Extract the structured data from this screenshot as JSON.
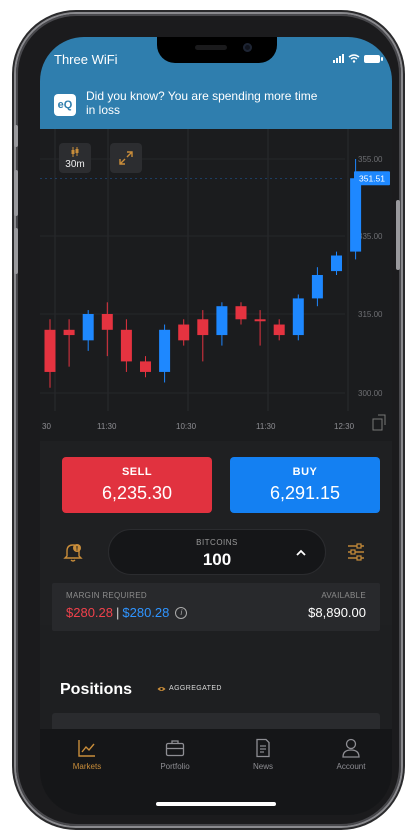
{
  "status_bar": {
    "carrier": "Three WiFi"
  },
  "tip_banner": {
    "logo_text": "eQ",
    "text": "Did you know? You are spending more time in loss"
  },
  "chart_toolbar": {
    "timeframe": "30m"
  },
  "chart_data": {
    "type": "candlestick",
    "y_ticks": [
      "355.00",
      "335.00",
      "315.00",
      "300.00"
    ],
    "x_ticks": [
      "30",
      "11:30",
      "10:30",
      "11:30",
      "12:30"
    ],
    "current_price_label": "351.51",
    "candles": [
      {
        "o": 312,
        "c": 304,
        "h": 314,
        "l": 301,
        "dir": "bearish"
      },
      {
        "o": 311,
        "c": 312,
        "h": 314,
        "l": 305,
        "dir": "bearish"
      },
      {
        "o": 310,
        "c": 315,
        "h": 316,
        "l": 308,
        "dir": "bullish"
      },
      {
        "o": 315,
        "c": 312,
        "h": 318,
        "l": 307,
        "dir": "bearish"
      },
      {
        "o": 312,
        "c": 306,
        "h": 314,
        "l": 304,
        "dir": "bearish"
      },
      {
        "o": 306,
        "c": 304,
        "h": 307,
        "l": 303,
        "dir": "bearish"
      },
      {
        "o": 304,
        "c": 312,
        "h": 313,
        "l": 302,
        "dir": "bullish"
      },
      {
        "o": 313,
        "c": 310,
        "h": 314,
        "l": 309,
        "dir": "bearish"
      },
      {
        "o": 314,
        "c": 311,
        "h": 316,
        "l": 306,
        "dir": "bearish"
      },
      {
        "o": 311,
        "c": 317,
        "h": 318,
        "l": 309,
        "dir": "bullish"
      },
      {
        "o": 317,
        "c": 314,
        "h": 318,
        "l": 313,
        "dir": "bearish"
      },
      {
        "o": 314,
        "c": 314,
        "h": 316,
        "l": 309,
        "dir": "bearish"
      },
      {
        "o": 313,
        "c": 311,
        "h": 314,
        "l": 310,
        "dir": "bearish"
      },
      {
        "o": 311,
        "c": 319,
        "h": 320,
        "l": 310,
        "dir": "bullish"
      },
      {
        "o": 319,
        "c": 325,
        "h": 327,
        "l": 317,
        "dir": "bullish"
      },
      {
        "o": 326,
        "c": 330,
        "h": 331,
        "l": 325,
        "dir": "bullish"
      },
      {
        "o": 331,
        "c": 350,
        "h": 355,
        "l": 329,
        "dir": "bullish"
      }
    ],
    "colors": {
      "bullish": "#1e88ff",
      "bearish": "#e53340"
    }
  },
  "trade": {
    "sell_label": "SELL",
    "sell_price": "6,235.30",
    "buy_label": "BUY",
    "buy_price": "6,291.15",
    "quantity_label": "BITCOINS",
    "quantity": "100"
  },
  "margin": {
    "label": "MARGIN REQUIRED",
    "value_red": "$280.28",
    "separator": "|",
    "value_blue": "$280.28",
    "available_label": "AVAILABLE",
    "available_value": "$8,890.00"
  },
  "positions": {
    "title": "Positions",
    "aggregated_label": "AGGREGATED"
  },
  "tabs": [
    {
      "label": "Markets",
      "icon": "chart-icon"
    },
    {
      "label": "Portfolio",
      "icon": "briefcase-icon"
    },
    {
      "label": "News",
      "icon": "news-icon"
    },
    {
      "label": "Account",
      "icon": "user-icon"
    }
  ],
  "colors": {
    "accent": "#c98d3a",
    "sell": "#e1323f",
    "buy": "#1480f2",
    "banner": "#2f7eae"
  }
}
